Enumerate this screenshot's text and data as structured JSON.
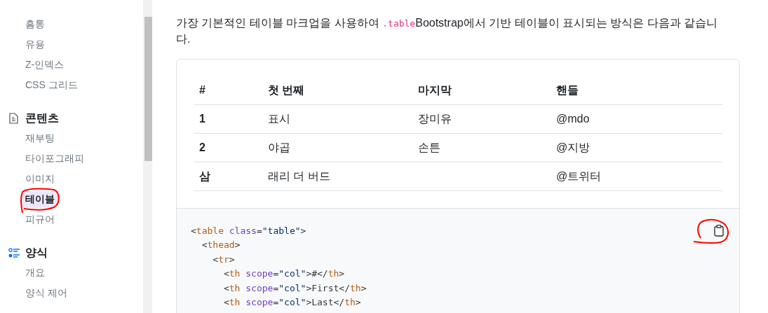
{
  "sidebar": {
    "groups": [
      {
        "items": [
          {
            "label": "흠통",
            "selected": false
          },
          {
            "label": "유용",
            "selected": false
          },
          {
            "label": "Z-인덱스",
            "selected": false
          },
          {
            "label": "CSS 그리드",
            "selected": false
          }
        ]
      },
      {
        "title": "콘텐츠",
        "items": [
          {
            "label": "재부팅",
            "selected": false
          },
          {
            "label": "타이포그래피",
            "selected": false
          },
          {
            "label": "이미지",
            "selected": false
          },
          {
            "label": "테이블",
            "selected": true
          },
          {
            "label": "피규어",
            "selected": false
          }
        ]
      },
      {
        "title": "양식",
        "items": [
          {
            "label": "개요",
            "selected": false
          },
          {
            "label": "양식 제어",
            "selected": false
          }
        ]
      }
    ]
  },
  "intro": [
    {
      "kind": "text",
      "text": "가장 기본적인 테이블 마크업을 사용하여 "
    },
    {
      "kind": "code",
      "text": ".table"
    },
    {
      "kind": "text",
      "text": "Bootstrap에서 기반 테이블이 표시되는 방식은 다음과 같습니다."
    }
  ],
  "table": {
    "columns": [
      "#",
      "첫 번째",
      "마지막",
      "핸들"
    ],
    "rows": [
      [
        "1",
        "표시",
        "장미유",
        "@mdo"
      ],
      [
        "2",
        "야곱",
        "손튼",
        "@지방"
      ],
      [
        "삼",
        "래리 더 버드",
        "",
        "@트위터"
      ]
    ]
  },
  "code": {
    "lines": [
      {
        "tokens": [
          {
            "kind": "punct",
            "text": "<"
          },
          {
            "kind": "tag",
            "text": "table"
          },
          {
            "kind": "attr",
            "text": " class"
          },
          {
            "kind": "punct",
            "text": "="
          },
          {
            "kind": "string",
            "text": "\"table\""
          },
          {
            "kind": "punct",
            "text": ">"
          }
        ]
      },
      {
        "tokens": [
          {
            "kind": "punct",
            "text": "  <"
          },
          {
            "kind": "tag",
            "text": "thead"
          },
          {
            "kind": "punct",
            "text": ">"
          }
        ]
      },
      {
        "tokens": [
          {
            "kind": "punct",
            "text": "    <"
          },
          {
            "kind": "tag",
            "text": "tr"
          },
          {
            "kind": "punct",
            "text": ">"
          }
        ]
      },
      {
        "tokens": [
          {
            "kind": "punct",
            "text": "      <"
          },
          {
            "kind": "tag",
            "text": "th"
          },
          {
            "kind": "attr",
            "text": " scope"
          },
          {
            "kind": "punct",
            "text": "="
          },
          {
            "kind": "string",
            "text": "\"col\""
          },
          {
            "kind": "punct",
            "text": ">#</"
          },
          {
            "kind": "tag",
            "text": "th"
          },
          {
            "kind": "punct",
            "text": ">"
          }
        ]
      },
      {
        "tokens": [
          {
            "kind": "punct",
            "text": "      <"
          },
          {
            "kind": "tag",
            "text": "th"
          },
          {
            "kind": "attr",
            "text": " scope"
          },
          {
            "kind": "punct",
            "text": "="
          },
          {
            "kind": "string",
            "text": "\"col\""
          },
          {
            "kind": "punct",
            "text": ">First</"
          },
          {
            "kind": "tag",
            "text": "th"
          },
          {
            "kind": "punct",
            "text": ">"
          }
        ]
      },
      {
        "tokens": [
          {
            "kind": "punct",
            "text": "      <"
          },
          {
            "kind": "tag",
            "text": "th"
          },
          {
            "kind": "attr",
            "text": " scope"
          },
          {
            "kind": "punct",
            "text": "="
          },
          {
            "kind": "string",
            "text": "\"col\""
          },
          {
            "kind": "punct",
            "text": ">Last</"
          },
          {
            "kind": "tag",
            "text": "th"
          },
          {
            "kind": "punct",
            "text": ">"
          }
        ]
      }
    ]
  }
}
